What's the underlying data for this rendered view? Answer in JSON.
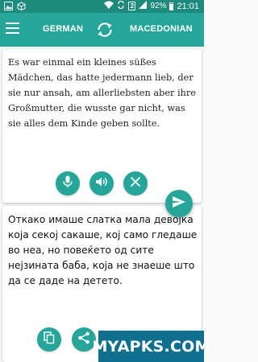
{
  "status_bar": {
    "battery": "92%",
    "time": "21:01",
    "sim_slot": "2",
    "left_icons": [
      "image-icon",
      "box-icon"
    ]
  },
  "toolbar": {
    "source_language": "GERMAN",
    "target_language": "MACEDONIAN",
    "accent_color": "#26a69a"
  },
  "source": {
    "text": "Es war einmal ein kleines süßes Mädchen, das hatte jedermann lieb, der sie nur ansah, am allerliebsten aber ihre Großmutter, die wusste gar nicht, was sie alles dem Kinde geben sollte.",
    "buttons": [
      "microphone-icon",
      "speaker-icon",
      "clear-icon"
    ]
  },
  "send_button": {
    "icon": "send-icon"
  },
  "target": {
    "text": "Откако имаше слатка мала девојка која секој сакаше, кој само гледаше во неа, но повеќето од сите нејзината баба, која не знаеше што да се даде на детето.",
    "buttons": [
      "copy-icon",
      "share-icon"
    ]
  },
  "watermark": {
    "text": "MYAPKS.COM"
  }
}
